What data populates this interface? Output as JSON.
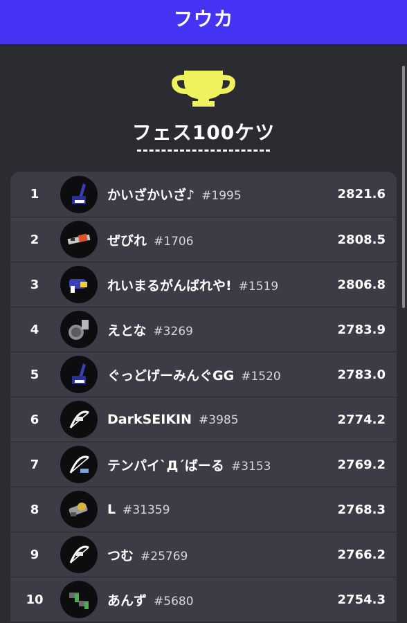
{
  "header": {
    "title": "フウカ"
  },
  "ranking": {
    "title": "フェス100ケツ",
    "entries": [
      {
        "rank": "1",
        "name": "かいざかいざ♪",
        "tag": "#1995",
        "score": "2821.6",
        "weapon_icon": "splat-charger-weapon-icon"
      },
      {
        "rank": "2",
        "name": "ぜびれ",
        "tag": "#1706",
        "score": "2808.5",
        "weapon_icon": "liter-weapon-icon"
      },
      {
        "rank": "3",
        "name": "れいまるがんばれや!",
        "tag": "#1519",
        "score": "2806.8",
        "weapon_icon": "blaster-weapon-icon"
      },
      {
        "rank": "4",
        "name": "えとな",
        "tag": "#3269",
        "score": "2783.9",
        "weapon_icon": "bucket-weapon-icon"
      },
      {
        "rank": "5",
        "name": "ぐっどげーみんぐGG",
        "tag": "#1520",
        "score": "2783.0",
        "weapon_icon": "splat-charger-weapon-icon"
      },
      {
        "rank": "6",
        "name": "DarkSEIKIN",
        "tag": "#3985",
        "score": "2774.2",
        "weapon_icon": "stringer-weapon-icon"
      },
      {
        "rank": "7",
        "name": "テンパイ`Д´ばーる",
        "tag": "#3153",
        "score": "2769.2",
        "weapon_icon": "stringer-weapon-icon"
      },
      {
        "rank": "8",
        "name": "L",
        "tag": "#31359",
        "score": "2768.3",
        "weapon_icon": "splatling-weapon-icon"
      },
      {
        "rank": "9",
        "name": "つむ",
        "tag": "#25769",
        "score": "2766.2",
        "weapon_icon": "stringer-weapon-icon"
      },
      {
        "rank": "10",
        "name": "あんず",
        "tag": "#5680",
        "score": "2754.3",
        "weapon_icon": "dualies-weapon-icon"
      }
    ]
  },
  "colors": {
    "header_bg": "#4433f2",
    "page_bg": "#2b2c31",
    "row_bg": "#3b3c45",
    "trophy": "#eef25c"
  }
}
